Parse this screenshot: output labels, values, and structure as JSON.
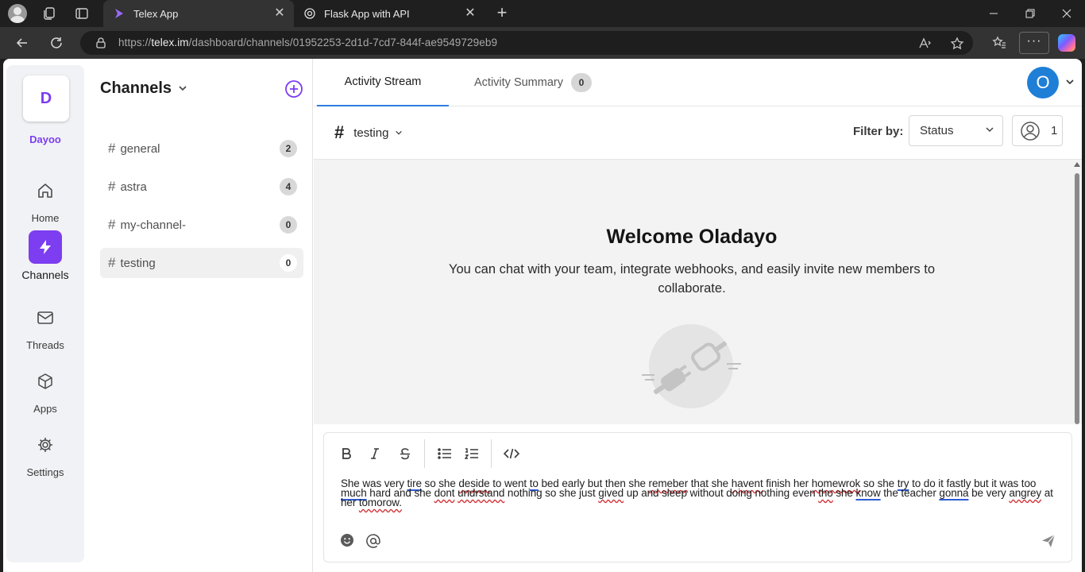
{
  "browser": {
    "tabs": [
      {
        "title": "Telex App",
        "active": true
      },
      {
        "title": "Flask App with API",
        "active": false
      }
    ],
    "url": {
      "scheme": "https://",
      "host": "telex.im",
      "path": "/dashboard/channels/01952253-2d1d-7cd7-844f-ae9549729eb9"
    }
  },
  "workspace": {
    "initial": "D",
    "name": "Dayoo"
  },
  "rail": {
    "items": [
      {
        "label": "Home",
        "icon": "home-icon"
      },
      {
        "label": "Channels",
        "icon": "lightning-icon",
        "active": true
      },
      {
        "label": "Threads",
        "icon": "mail-icon"
      },
      {
        "label": "Apps",
        "icon": "cube-icon"
      },
      {
        "label": "Settings",
        "icon": "gear-icon"
      }
    ]
  },
  "channels": {
    "header": "Channels",
    "items": [
      {
        "name": "general",
        "count": "2"
      },
      {
        "name": "astra",
        "count": "4"
      },
      {
        "name": "my-channel-",
        "count": "0"
      },
      {
        "name": "testing",
        "count": "0",
        "active": true
      }
    ]
  },
  "main": {
    "tabs": [
      {
        "label": "Activity Stream",
        "active": true
      },
      {
        "label": "Activity Summary",
        "badge": "0"
      }
    ],
    "user_initial": "O",
    "current_channel": "testing",
    "filter_label": "Filter by:",
    "filter_value": "Status",
    "member_count": "1",
    "welcome_title": "Welcome Oladayo",
    "welcome_text": "You can chat with your team, integrate webhooks, and easily invite new members to collaborate."
  },
  "composer": {
    "toolbar": [
      "bold-icon",
      "italic-icon",
      "strikethrough-icon",
      "bullet-list-icon",
      "numbered-list-icon",
      "code-icon"
    ],
    "text": "She was very tire so she deside to went to bed early but then she remeber that she havent finish her homewrok so she try to do it fastly but it was too much hard and she dont undrstand nothing so she just gived up and sleep without doing nothing even tho she know the teacher gonna be very angrey at her tomorow."
  },
  "colors": {
    "accent": "#7d3df0",
    "tab_underline": "#2f7de1",
    "user_avatar": "#1f7fd6"
  }
}
